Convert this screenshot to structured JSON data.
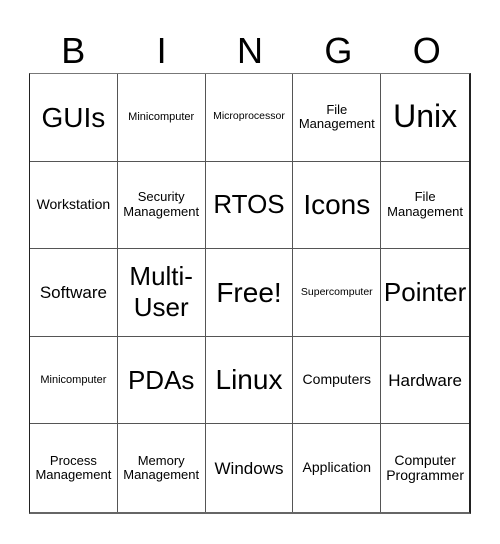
{
  "title_letters": [
    "B",
    "I",
    "N",
    "G",
    "O"
  ],
  "cells": [
    {
      "text": "GUIs"
    },
    {
      "text": "Minicomputer"
    },
    {
      "text": "Microprocessor"
    },
    {
      "text": "File Management"
    },
    {
      "text": "Unix"
    },
    {
      "text": "Workstation"
    },
    {
      "text": "Security Management"
    },
    {
      "text": "RTOS"
    },
    {
      "text": "Icons"
    },
    {
      "text": "File Management"
    },
    {
      "text": "Software"
    },
    {
      "text": "Multi-User"
    },
    {
      "text": "Free!"
    },
    {
      "text": "Supercomputer"
    },
    {
      "text": "Pointer"
    },
    {
      "text": "Minicomputer"
    },
    {
      "text": "PDAs"
    },
    {
      "text": "Linux"
    },
    {
      "text": "Computers"
    },
    {
      "text": "Hardware"
    },
    {
      "text": "Process Management"
    },
    {
      "text": "Memory Management"
    },
    {
      "text": "Windows"
    },
    {
      "text": "Application"
    },
    {
      "text": "Computer Programmer"
    }
  ]
}
